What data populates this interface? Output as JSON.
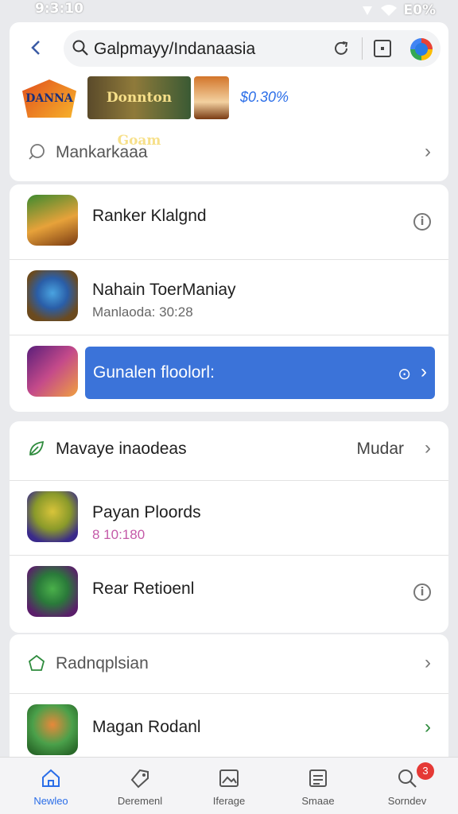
{
  "status_bar": {
    "time": "9:3:10",
    "battery": "E0%"
  },
  "browser": {
    "search_text": "Galpmayy/Indanaasia"
  },
  "banner": {
    "logo_text": "DANNA",
    "game_title": "Donnton Goam",
    "price": "$0.30%"
  },
  "search_history_label": "Mankarkaaa",
  "apps_top": [
    {
      "title": "Ranker Klalgnd"
    },
    {
      "title": "Nahain ToerManiay",
      "subtitle": "Manlaoda: 30:28"
    }
  ],
  "cta": {
    "label": "Gunalen floolorl:"
  },
  "mid_section": {
    "header_label": "Mavaye inaodeas",
    "header_extra": "Mudar",
    "apps": [
      {
        "title": "Payan Ploords",
        "subtitle": "8 10:180"
      },
      {
        "title": "Rear Retioenl"
      }
    ]
  },
  "bottom_section": {
    "header_label": "Radnqplsian",
    "apps": [
      {
        "title": "Magan Rodanl"
      }
    ]
  },
  "nav": [
    {
      "label": "Newleo",
      "icon": "home-icon"
    },
    {
      "label": "Deremenl",
      "icon": "tag-icon"
    },
    {
      "label": "Iferage",
      "icon": "image-icon"
    },
    {
      "label": "Smaae",
      "icon": "list-icon"
    },
    {
      "label": "Sorndev",
      "icon": "search-icon",
      "badge": "3"
    }
  ],
  "colors": {
    "accent": "#2b6ee8",
    "cta": "#3b73d9",
    "badge": "#e53935"
  }
}
